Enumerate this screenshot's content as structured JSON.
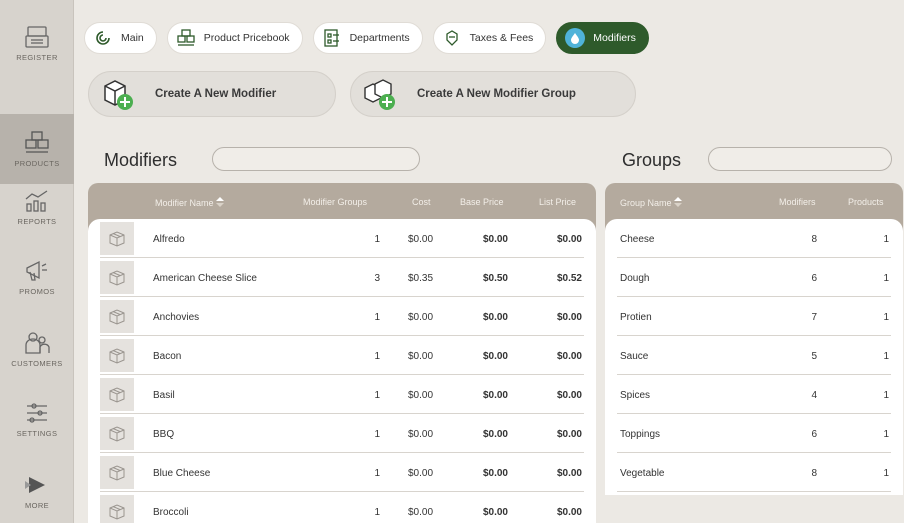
{
  "sidebar": {
    "items": [
      {
        "label": "REGISTER",
        "icon": "register-icon"
      },
      {
        "label": "PRODUCTS",
        "icon": "products-icon",
        "active": true
      },
      {
        "label": "REPORTS",
        "icon": "reports-icon"
      },
      {
        "label": "PROMOS",
        "icon": "megaphone-icon"
      },
      {
        "label": "CUSTOMERS",
        "icon": "customers-icon"
      },
      {
        "label": "SETTINGS",
        "icon": "sliders-icon"
      },
      {
        "label": "MORE",
        "icon": "play-icon"
      }
    ]
  },
  "tabs": [
    {
      "label": "Main",
      "icon": "swirl-icon"
    },
    {
      "label": "Product Pricebook",
      "icon": "pricebook-icon"
    },
    {
      "label": "Departments",
      "icon": "departments-icon"
    },
    {
      "label": "Taxes & Fees",
      "icon": "taxes-icon"
    },
    {
      "label": "Modifiers",
      "icon": "modifier-drop-icon",
      "active": true
    }
  ],
  "actions": {
    "create_modifier": "Create A New Modifier",
    "create_group": "Create A New Modifier Group"
  },
  "modifiers": {
    "title": "Modifiers",
    "search_placeholder": "",
    "columns": [
      "Modifier Name",
      "Modifier Groups",
      "Cost",
      "Base Price",
      "List Price"
    ],
    "rows": [
      {
        "name": "Alfredo",
        "groups": "1",
        "cost": "$0.00",
        "base": "$0.00",
        "list": "$0.00"
      },
      {
        "name": "American Cheese Slice",
        "groups": "3",
        "cost": "$0.35",
        "base": "$0.50",
        "list": "$0.52"
      },
      {
        "name": "Anchovies",
        "groups": "1",
        "cost": "$0.00",
        "base": "$0.00",
        "list": "$0.00"
      },
      {
        "name": "Bacon",
        "groups": "1",
        "cost": "$0.00",
        "base": "$0.00",
        "list": "$0.00"
      },
      {
        "name": "Basil",
        "groups": "1",
        "cost": "$0.00",
        "base": "$0.00",
        "list": "$0.00"
      },
      {
        "name": "BBQ",
        "groups": "1",
        "cost": "$0.00",
        "base": "$0.00",
        "list": "$0.00"
      },
      {
        "name": "Blue Cheese",
        "groups": "1",
        "cost": "$0.00",
        "base": "$0.00",
        "list": "$0.00"
      },
      {
        "name": "Broccoli",
        "groups": "1",
        "cost": "$0.00",
        "base": "$0.00",
        "list": "$0.00"
      }
    ]
  },
  "groups": {
    "title": "Groups",
    "search_placeholder": "",
    "columns": [
      "Group Name",
      "Modifiers",
      "Products"
    ],
    "rows": [
      {
        "name": "Cheese",
        "modifiers": "8",
        "products": "1"
      },
      {
        "name": "Dough",
        "modifiers": "6",
        "products": "1"
      },
      {
        "name": "Protien",
        "modifiers": "7",
        "products": "1"
      },
      {
        "name": "Sauce",
        "modifiers": "5",
        "products": "1"
      },
      {
        "name": "Spices",
        "modifiers": "4",
        "products": "1"
      },
      {
        "name": "Toppings",
        "modifiers": "6",
        "products": "1"
      },
      {
        "name": "Vegetable",
        "modifiers": "8",
        "products": "1"
      }
    ]
  },
  "colors": {
    "active_tab": "#2e5a2b",
    "accent_green": "#4caf50",
    "header_bar": "#b4aa9e",
    "sidebar_bg": "#d7d3cd"
  }
}
